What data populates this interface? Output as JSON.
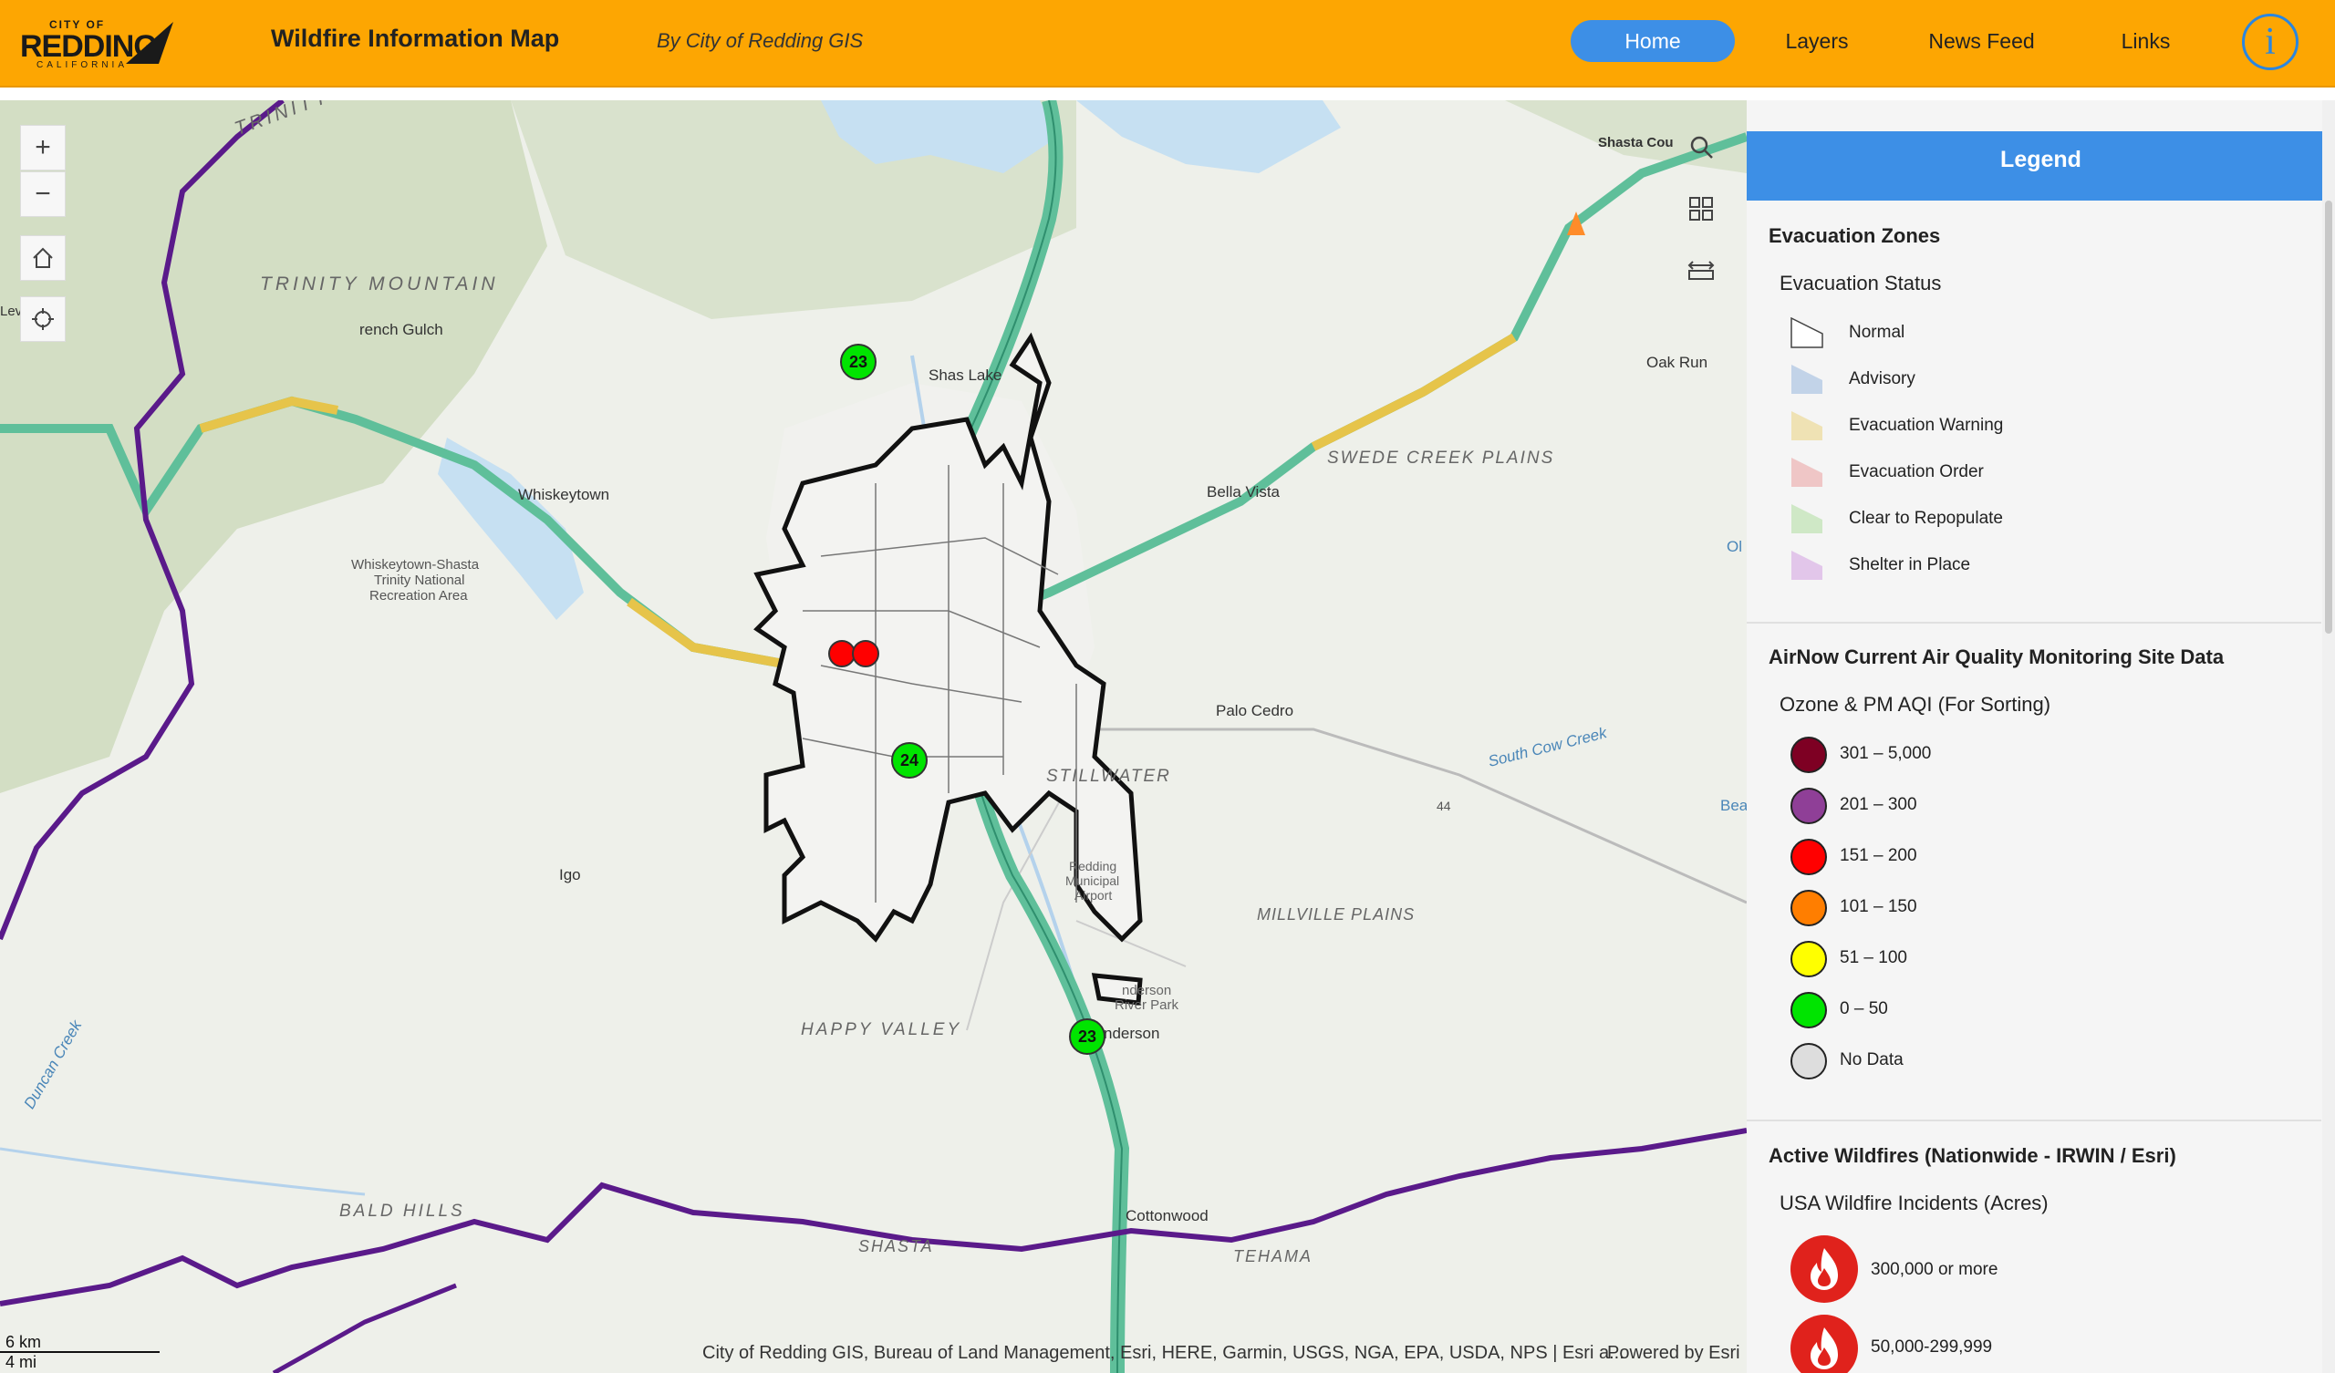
{
  "header": {
    "logo": {
      "city": "CITY OF",
      "name": "REDDING",
      "state": "CALIFORNIA"
    },
    "title": "Wildfire Information Map",
    "subtitle": "By City of Redding GIS",
    "nav": [
      "Home",
      "Layers",
      "News Feed",
      "Links"
    ],
    "active_nav": "Home",
    "info_label": "i"
  },
  "map": {
    "controls": {
      "zoom_in": "+",
      "zoom_out": "−"
    },
    "labels": {
      "trinity_top": "TRINITY",
      "trinity_mountain": "TRINITY MOUNTAIN",
      "french_gulch": "rench Gulch",
      "whiskeytown": "Whiskeytown",
      "nra_1": "Whiskeytown-Shasta",
      "nra_2": "Trinity National",
      "nra_3": "Recreation Area",
      "shasta_lake": "Shas   Lake",
      "shasta_county": "Shasta Cou",
      "oak_run": "Oak Run",
      "swede_creek": "SWEDE CREEK PLAINS",
      "bella_vista": "Bella Vista",
      "palo_cedro": "Palo Cedro",
      "south_cow_creek": "South Cow Creek",
      "stillwater": "STILLWATER",
      "millville": "MILLVILLE PLAINS",
      "igo": "Igo",
      "happy_valley": "HAPPY VALLEY",
      "anderson": "nderson",
      "bald_hills": "BALD HILLS",
      "shasta_bottom": "SHASTA",
      "tehama": "TEHAMA",
      "cottonwood": "Cottonwood",
      "duncan_creek": "Duncan Creek",
      "airport_1": "Redding",
      "airport_2": "Municipal",
      "airport_3": "Airport",
      "river_park": "River Park",
      "anderson_rp": "nderson",
      "hwy_44": "44",
      "lev": "Lev",
      "ol": "Ol",
      "bea": "Bea"
    },
    "aqi_markers": [
      "23",
      "24",
      "23"
    ],
    "scale": {
      "km": "6 km",
      "mi": "4 mi"
    },
    "attribution": "City of Redding GIS, Bureau of Land Management, Esri, HERE, Garmin, USGS, NGA, EPA, USDA, NPS | Esri a...",
    "powered_by": "Powered by Esri"
  },
  "legend": {
    "title": "Legend",
    "evacuation": {
      "section": "Evacuation Zones",
      "subtitle": "Evacuation Status",
      "items": [
        {
          "label": "Normal",
          "color": "#ffffff"
        },
        {
          "label": "Advisory",
          "color": "#c2d3e8"
        },
        {
          "label": "Evacuation Warning",
          "color": "#efe2b4"
        },
        {
          "label": "Evacuation Order",
          "color": "#efc6c6"
        },
        {
          "label": "Clear to Repopulate",
          "color": "#cfe8c6"
        },
        {
          "label": "Shelter in Place",
          "color": "#e2c6ea"
        }
      ]
    },
    "airnow": {
      "section": "AirNow Current Air Quality Monitoring Site Data",
      "subtitle": "Ozone & PM AQI (For Sorting)",
      "items": [
        {
          "label": "301 – 5,000",
          "color": "#7e0023"
        },
        {
          "label": "201 – 300",
          "color": "#8f3f97"
        },
        {
          "label": "151 – 200",
          "color": "#ff0000"
        },
        {
          "label": "101 – 150",
          "color": "#ff7e00"
        },
        {
          "label": "51 – 100",
          "color": "#ffff00"
        },
        {
          "label": "0 – 50",
          "color": "#00e400"
        },
        {
          "label": "No Data",
          "color": "#dddddd"
        }
      ]
    },
    "wildfires": {
      "section": "Active Wildfires (Nationwide - IRWIN / Esri)",
      "subtitle": "USA Wildfire Incidents (Acres)",
      "items": [
        {
          "label": "300,000 or more"
        },
        {
          "label": "50,000-299,999"
        }
      ]
    }
  }
}
